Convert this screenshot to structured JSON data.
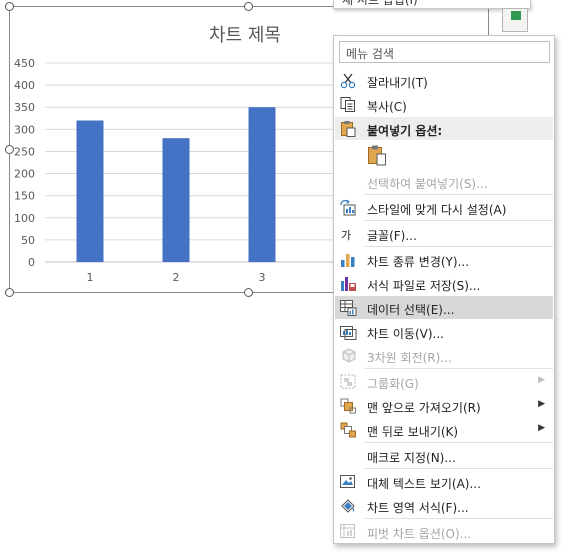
{
  "chart_data": {
    "type": "bar",
    "title": "차트 제목",
    "categories": [
      "1",
      "2",
      "3"
    ],
    "series": [
      {
        "values": [
          320,
          280,
          350
        ]
      }
    ],
    "ylim": [
      0,
      450
    ],
    "yticks": [
      0,
      50,
      100,
      150,
      200,
      250,
      300,
      350,
      400,
      450
    ],
    "grid": true,
    "colors": {
      "bar": "#4472C4",
      "grid": "#d9d9d9",
      "axis": "#bfbfbf"
    }
  },
  "top_peek": {
    "label": "새 시트 삽입(I)"
  },
  "menu": {
    "search_placeholder": "메뉴 검색",
    "items": [
      {
        "icon": "scissors-icon",
        "label": "잘라내기(T)"
      },
      {
        "icon": "copy-icon",
        "label": "복사(C)"
      },
      {
        "icon": "clipboard-icon",
        "label": "붙여넣기 옵션:"
      },
      {
        "icon": "paste-icon",
        "label": ""
      },
      {
        "icon": "",
        "label": "선택하여 붙여넣기(S)..."
      },
      {
        "icon": "reset-style-icon",
        "label": "스타일에 맞게 다시 설정(A)"
      },
      {
        "icon": "font-icon",
        "label": "글꼴(F)..."
      },
      {
        "icon": "change-chart-type-icon",
        "label": "차트 종류 변경(Y)..."
      },
      {
        "icon": "save-template-icon",
        "label": "서식 파일로 저장(S)..."
      },
      {
        "icon": "select-data-icon",
        "label": "데이터 선택(E)..."
      },
      {
        "icon": "move-chart-icon",
        "label": "차트 이동(V)..."
      },
      {
        "icon": "3d-rotation-icon",
        "label": "3차원 회전(R)..."
      },
      {
        "icon": "group-icon",
        "label": "그룹화(G)"
      },
      {
        "icon": "bring-to-front-icon",
        "label": "맨 앞으로 가져오기(R)"
      },
      {
        "icon": "send-to-back-icon",
        "label": "맨 뒤로 보내기(K)"
      },
      {
        "icon": "",
        "label": "매크로 지정(N)..."
      },
      {
        "icon": "alt-text-icon",
        "label": "대체 텍스트 보기(A)..."
      },
      {
        "icon": "format-chart-area-icon",
        "label": "차트 영역 서식(F)..."
      },
      {
        "icon": "pivot-chart-options-icon",
        "label": "피벗 차트 옵션(O)..."
      }
    ],
    "font_icon_glyph": "가"
  }
}
